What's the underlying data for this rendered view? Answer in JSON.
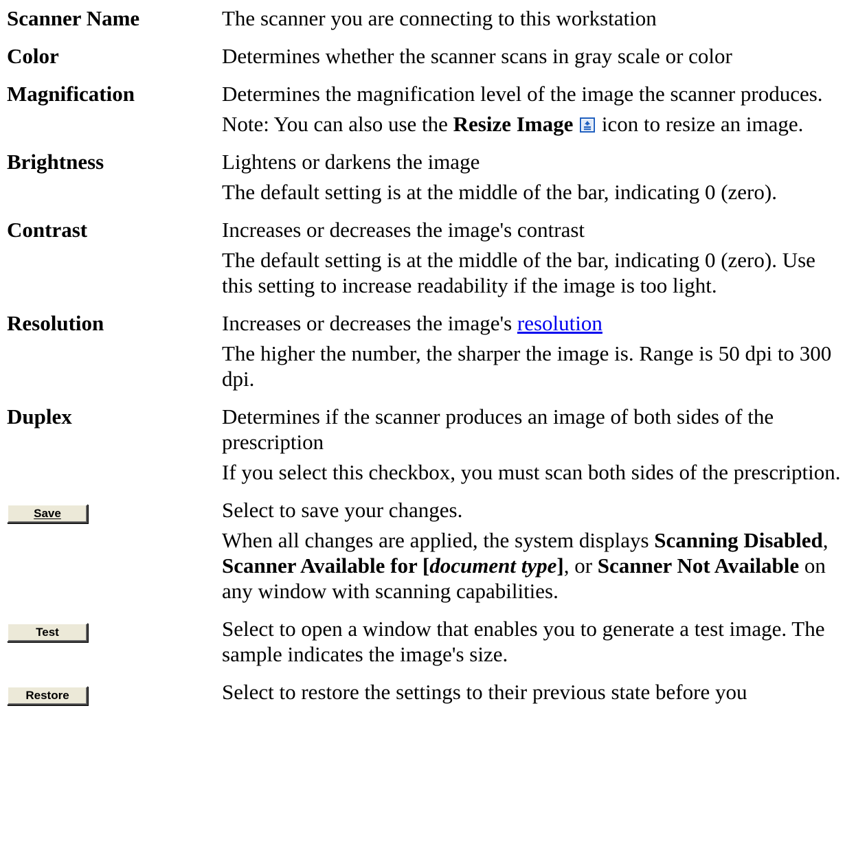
{
  "rows": [
    {
      "term": "Scanner Name",
      "lines": [
        "The scanner you are connecting to this workstation"
      ]
    },
    {
      "term": "Color",
      "lines": [
        "Determines whether the scanner scans in gray scale or color"
      ]
    },
    {
      "term": "Magnification",
      "lines": [
        "Determines the magnification level of the image the scanner produces."
      ],
      "note": {
        "prefix": "Note: You can also use the ",
        "bold": "Resize Image",
        "suffix": " icon to resize an image.",
        "icon": "resize-image-icon"
      }
    },
    {
      "term": "Brightness",
      "lines": [
        "Lightens or darkens the image",
        "The default setting is at the middle of the bar, indicating 0 (zero)."
      ]
    },
    {
      "term": "Contrast",
      "lines": [
        "Increases or decreases the image's contrast",
        "The default setting is at the middle of the bar, indicating 0 (zero). Use this setting to increase readability if the image is too light."
      ]
    },
    {
      "term": "Resolution",
      "first_prefix": "Increases or decreases the image's ",
      "link": "resolution",
      "lines": [
        "The higher the number, the sharper the image is. Range is 50 dpi to 300 dpi."
      ]
    },
    {
      "term": "Duplex",
      "lines": [
        "Determines if the scanner produces an image of both sides of the prescription",
        "If you select this checkbox, you must scan both sides of the prescription."
      ]
    }
  ],
  "save": {
    "button": "Save",
    "line1": "Select to save your changes.",
    "p1": "When all changes are applied, the system displays ",
    "b1": "Scanning Disabled",
    "p2": ", ",
    "b2": "Scanner Available for [",
    "bi": "document type",
    "b3": "]",
    "p3": ", or ",
    "b4": "Scanner Not Available",
    "p4": " on any window with scanning capabilities."
  },
  "test": {
    "button": "Test",
    "text": "Select to open a window that enables you to generate a test image. The sample indicates the image's size."
  },
  "restore": {
    "button": "Restore",
    "text": "Select to restore the settings to their previous state before you"
  },
  "colors": {
    "link": "#0000ee",
    "button_face": "#ece9d8",
    "icon_blue": "#1f5fbf"
  }
}
